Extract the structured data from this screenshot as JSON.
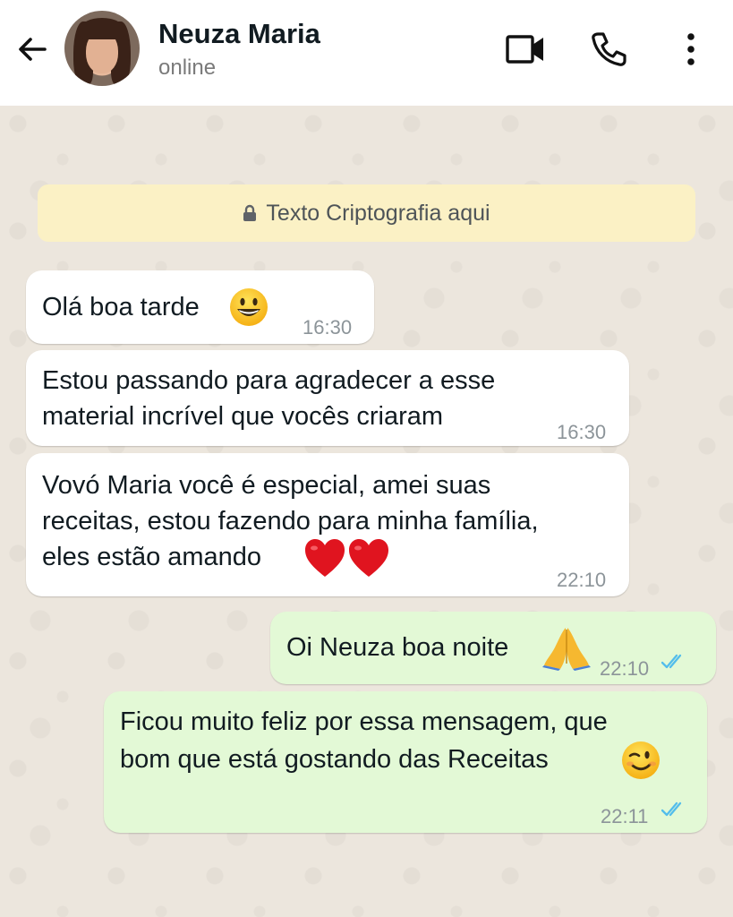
{
  "header": {
    "contact_name": "Neuza Maria",
    "status": "online",
    "icons": {
      "back": "arrow-left-icon",
      "video": "video-camera-icon",
      "call": "phone-icon",
      "menu": "more-vertical-icon"
    }
  },
  "chat": {
    "encryption_notice": "Texto Criptografia aqui",
    "messages": [
      {
        "direction": "incoming",
        "lines": [
          "Olá boa tarde"
        ],
        "emoji": "grinning-face",
        "time": "16:30"
      },
      {
        "direction": "incoming",
        "lines": [
          "Estou passando para agradecer a esse",
          "material incrível que vocês criaram"
        ],
        "time": "16:30"
      },
      {
        "direction": "incoming",
        "lines": [
          "Vovó Maria você é especial, amei suas",
          "receitas, estou fazendo para minha família,",
          "eles estão amando"
        ],
        "emoji": "two-red-hearts",
        "time": "22:10"
      },
      {
        "direction": "outgoing",
        "lines": [
          "Oi Neuza boa noite"
        ],
        "emoji": "folded-hands",
        "time": "22:10",
        "read": true
      },
      {
        "direction": "outgoing",
        "lines": [
          "Ficou muito feliz por essa mensagem, que",
          "bom que está gostando das Receitas"
        ],
        "emoji": "winking-face",
        "time": "22:11",
        "read": true
      }
    ]
  },
  "colors": {
    "incoming_bubble": "#ffffff",
    "outgoing_bubble": "#e3f9d6",
    "notice_background": "#fbf1c5",
    "read_ticks": "#53bdeb",
    "chat_background": "#ece6dd"
  }
}
